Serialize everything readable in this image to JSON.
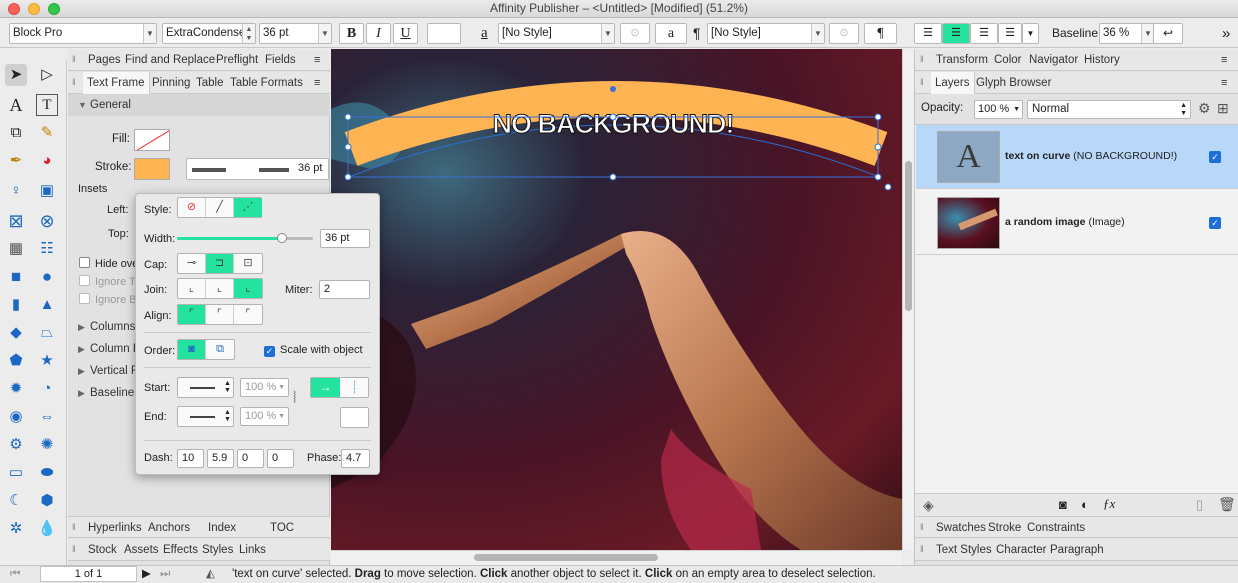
{
  "window": {
    "title": "Affinity Publisher – <Untitled> [Modified] (51.2%)"
  },
  "toolbar": {
    "font_family": "Block Pro",
    "font_style": "ExtraCondensed",
    "font_size": "36 pt",
    "bold": "B",
    "italic": "I",
    "underline": "U",
    "char_style_glyph": "a",
    "char_style": "[No Style]",
    "char_style_preview": "a",
    "para_glyph": "¶",
    "para_style": "[No Style]",
    "para_style_preview": "¶",
    "baseline_label": "Baseline:",
    "baseline_value": "36 %",
    "overflow": "»"
  },
  "left_panel": {
    "tabs_top": [
      "Pages",
      "Find and Replace",
      "Preflight",
      "Fields"
    ],
    "tabs": [
      "Text Frame",
      "Pinning",
      "Table",
      "Table Formats"
    ],
    "section_general": "General",
    "fill_label": "Fill:",
    "stroke_label": "Stroke:",
    "stroke_width": "36 pt",
    "insets_label": "Insets",
    "left_label": "Left:",
    "top_label": "Top:",
    "hide_overflow": "Hide ove",
    "ignore_text": "Ignore T",
    "ignore_b": "Ignore B",
    "sections": [
      "Columns",
      "Column R",
      "Vertical F",
      "Baseline G"
    ],
    "bottom_tabs_1": [
      "Hyperlinks",
      "Anchors",
      "Index",
      "TOC"
    ],
    "bottom_tabs_2": [
      "Stock",
      "Assets",
      "Effects",
      "Styles",
      "Links"
    ]
  },
  "stroke_popover": {
    "style_label": "Style:",
    "width_label": "Width:",
    "width_value": "36 pt",
    "width_fraction": 0.77,
    "cap_label": "Cap:",
    "join_label": "Join:",
    "miter_label": "Miter:",
    "miter_value": "2",
    "align_label": "Align:",
    "order_label": "Order:",
    "scale_label": "Scale with object",
    "start_label": "Start:",
    "end_label": "End:",
    "start_pct": "100 %",
    "end_pct": "100 %",
    "dash_label": "Dash:",
    "dash_values": [
      "10",
      "5.9",
      "0",
      "0"
    ],
    "phase_label": "Phase:",
    "phase_value": "4.7"
  },
  "canvas": {
    "curve_text": "NO BACKGROUND!",
    "stroke_color": "#ffb454"
  },
  "right_panel": {
    "tabs_top": [
      "Transform",
      "Color",
      "Navigator",
      "History"
    ],
    "tabs": [
      "Layers",
      "Glyph Browser"
    ],
    "opacity_label": "Opacity:",
    "opacity_value": "100 %",
    "blend_mode": "Normal",
    "layers": [
      {
        "name": "text on curve",
        "type": " (NO BACKGROUND!)",
        "thumb_glyph": "A",
        "checked": "✓"
      },
      {
        "name": "a random image",
        "type": " (Image)",
        "checked": "✓"
      }
    ],
    "bottom_tabs_1": [
      "Swatches",
      "Stroke",
      "Constraints"
    ],
    "bottom_tabs_2": [
      "Text Styles",
      "Character",
      "Paragraph"
    ]
  },
  "status": {
    "page": "1 of 1",
    "message_parts": [
      "'text on curve' selected. ",
      "Drag",
      " to move selection. ",
      "Click",
      " another object to select it. ",
      "Click",
      " on an empty area to deselect selection."
    ]
  },
  "colors": {
    "accent": "#23e39f",
    "selection": "#b9d7f8",
    "stroke": "#ffb454"
  }
}
